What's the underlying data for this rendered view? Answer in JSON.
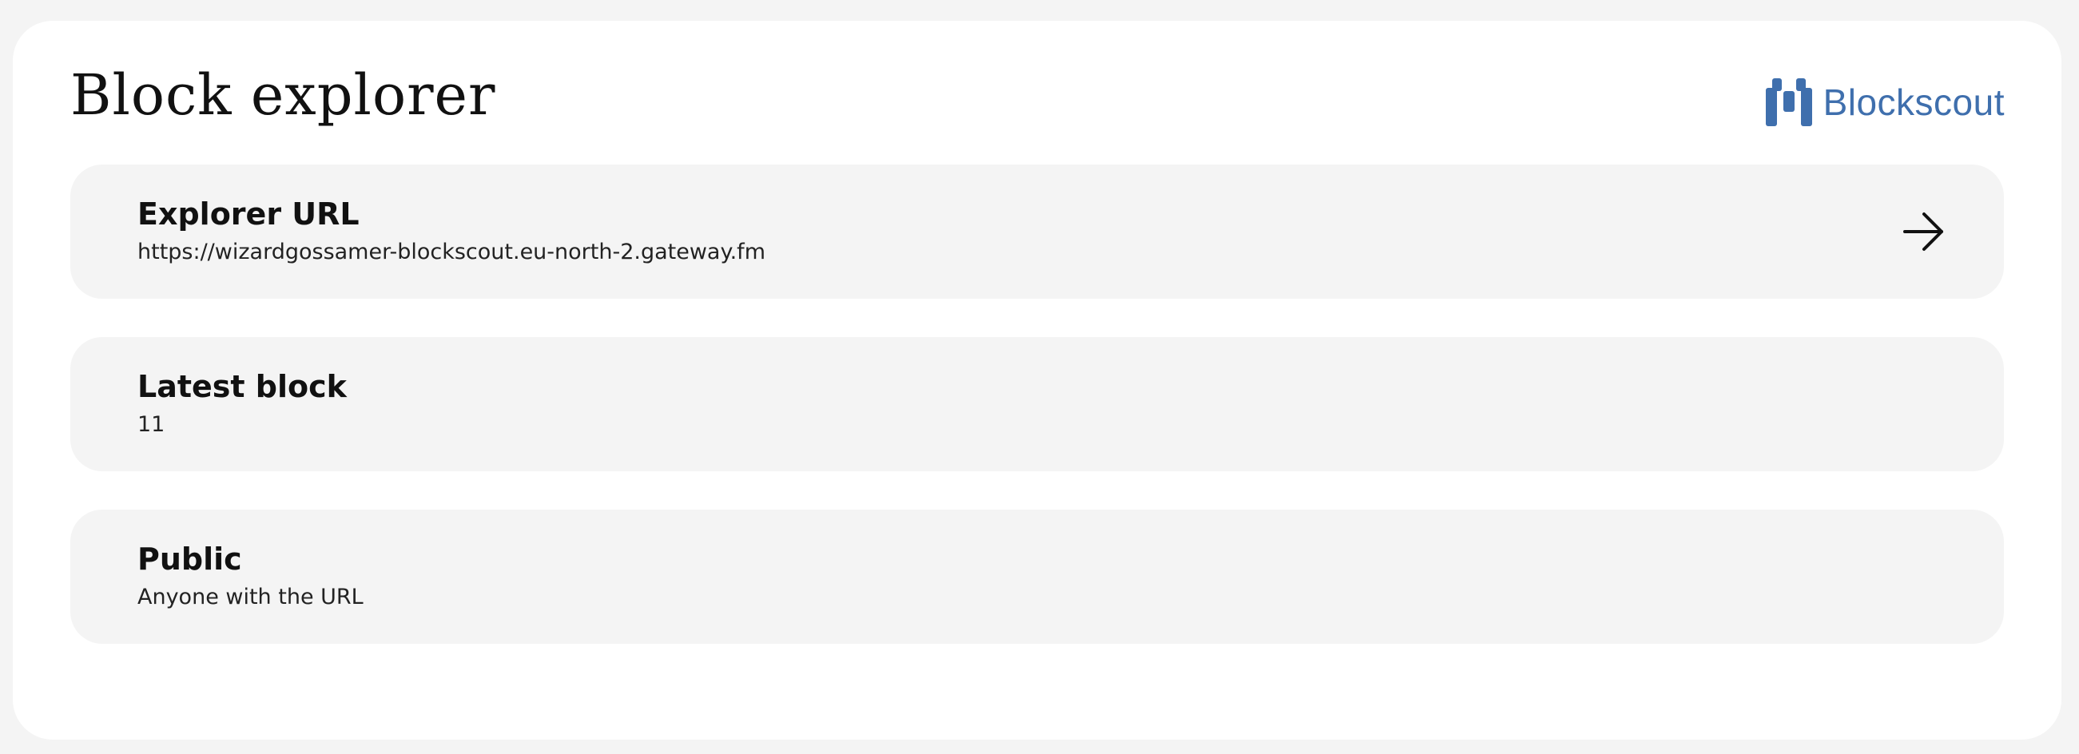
{
  "header": {
    "title": "Block explorer",
    "brand_name": "Blockscout",
    "brand_icon": "blockscout-logo-icon",
    "brand_color": "#3f6fad"
  },
  "cards": [
    {
      "title": "Explorer URL",
      "value": "https://wizardgossamer-blockscout.eu-north-2.gateway.fm",
      "icon": "arrow-right-icon"
    },
    {
      "title": "Latest block",
      "value": "11"
    },
    {
      "title": "Public",
      "value": "Anyone with the URL"
    }
  ],
  "colors": {
    "page_background": "#f4f4f4",
    "panel_background": "#ffffff",
    "card_background": "#f4f4f4",
    "text": "#111111"
  }
}
